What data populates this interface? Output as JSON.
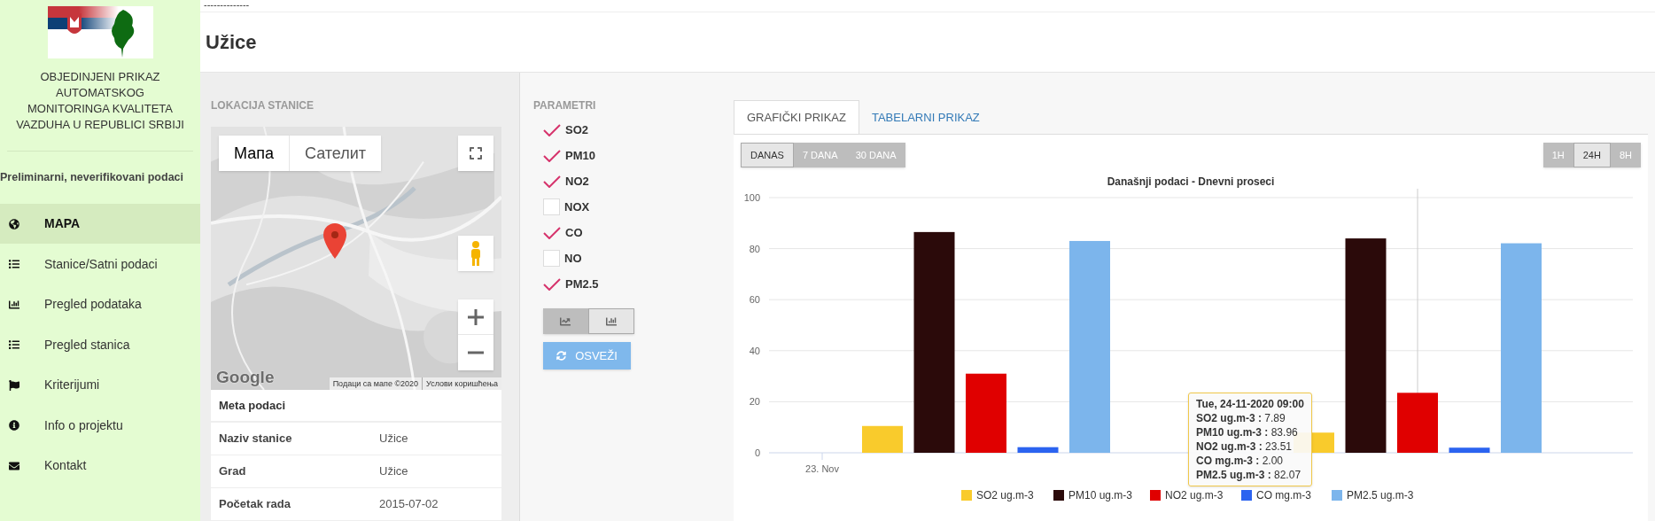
{
  "sidebar": {
    "title": "OBJEDINJENI PRIKAZ AUTOMATSKOG MONITORINGA KVALITETA VAZDUHA U REPUBLICI SRBIJI",
    "subtitle": "Preliminarni, neverifikovani podaci",
    "items": [
      {
        "label": "MAPA",
        "selected": true
      },
      {
        "label": "Stanice/Satni podaci",
        "selected": false
      },
      {
        "label": "Pregled podataka",
        "selected": false
      },
      {
        "label": "Pregled stanica",
        "selected": false
      },
      {
        "label": "Kriterijumi",
        "selected": false
      },
      {
        "label": "Info o projektu",
        "selected": false
      },
      {
        "label": "Kontakt",
        "selected": false
      }
    ]
  },
  "header": {
    "dashes": "--------------",
    "title": "Užice"
  },
  "station": {
    "heading": "LOKACIJA STANICE",
    "map": {
      "map_types": [
        {
          "label": "Мапа",
          "selected": true
        },
        {
          "label": "Сателит",
          "selected": false
        }
      ],
      "logo": "Google",
      "attribution": "Подаци са мапе ©2020",
      "terms": "Услови коришћења"
    },
    "meta": {
      "heading": "Meta podaci",
      "rows": [
        {
          "label": "Naziv stanice",
          "value": "Užice"
        },
        {
          "label": "Grad",
          "value": "Užice"
        },
        {
          "label": "Početak rada",
          "value": "2015-07-02"
        }
      ]
    }
  },
  "parameters": {
    "heading": "PARAMETRI",
    "items": [
      {
        "label": "SO2",
        "checked": true
      },
      {
        "label": "PM10",
        "checked": true
      },
      {
        "label": "NO2",
        "checked": true
      },
      {
        "label": "NOX",
        "checked": false
      },
      {
        "label": "CO",
        "checked": true
      },
      {
        "label": "NO",
        "checked": false
      },
      {
        "label": "PM2.5",
        "checked": true
      }
    ],
    "chart_types": [
      {
        "selected": false
      },
      {
        "selected": true
      }
    ],
    "refresh": "OSVEŽI"
  },
  "chart_panel": {
    "tabs": [
      {
        "label": "GRAFIČKI PRIKAZ",
        "selected": true
      },
      {
        "label": "TABELARNI PRIKAZ",
        "selected": false
      }
    ],
    "ranges": [
      {
        "label": "DANAS",
        "selected": true
      },
      {
        "label": "7 DANA",
        "selected": false
      },
      {
        "label": "30 DANA",
        "selected": false
      }
    ],
    "intervals": [
      {
        "label": "1H",
        "selected": false
      },
      {
        "label": "24H",
        "selected": true
      },
      {
        "label": "8H",
        "selected": false
      }
    ],
    "chart_data": {
      "type": "bar",
      "title": "Današnji podaci - Dnevni proseci",
      "categories": [
        "23. Nov",
        null
      ],
      "ylim": [
        0,
        100
      ],
      "grid": true,
      "legend": true,
      "yticks": [
        0,
        20,
        40,
        60,
        80,
        100
      ],
      "series": [
        {
          "name": "SO2 ug.m-3",
          "color": "#f9cb2c",
          "values": [
            10.5,
            7.9
          ]
        },
        {
          "name": "PM10 ug.m-3",
          "color": "#2b0a0a",
          "values": [
            86.5,
            84
          ]
        },
        {
          "name": "NO2 ug.m-3",
          "color": "#e00000",
          "values": [
            31,
            23.5
          ]
        },
        {
          "name": "CO mg.m-3",
          "color": "#2b63f0",
          "values": [
            2.2,
            2.0
          ]
        },
        {
          "name": "PM2.5 ug.m-3",
          "color": "#7cb5ec",
          "values": [
            83,
            82.1
          ]
        }
      ]
    },
    "tooltip": {
      "title": "Tue, 24-11-2020 09:00",
      "lines": [
        "**SO2 ug.m-3 :** 7.89",
        "**PM10 ug.m-3 :** 83.96",
        "**NO2 ug.m-3 :** 23.51",
        "**CO mg.m-3 :** 2.00",
        "**PM2.5 ug.m-3 :** 82.07"
      ]
    }
  }
}
